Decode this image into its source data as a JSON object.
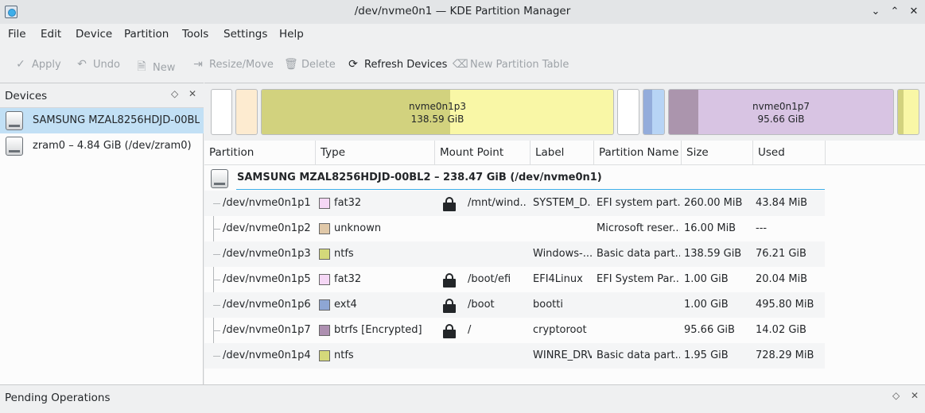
{
  "window": {
    "title": "/dev/nvme0n1 — KDE Partition Manager"
  },
  "menu": [
    "File",
    "Edit",
    "Device",
    "Partition",
    "Tools",
    "Settings",
    "Help"
  ],
  "toolbar": {
    "apply": "Apply",
    "undo": "Undo",
    "new": "New",
    "resize": "Resize/Move",
    "delete": "Delete",
    "refresh": "Refresh Devices",
    "new_table": "New Partition Table"
  },
  "devices": {
    "title": "Devices",
    "items": [
      {
        "label": "SAMSUNG MZAL8256HDJD-00BL..."
      },
      {
        "label": "zram0 – 4.84 GiB (/dev/zram0)"
      }
    ]
  },
  "bar": {
    "p3": {
      "name": "nvme0n1p3",
      "size": "138.59 GiB"
    },
    "p7": {
      "name": "nvme0n1p7",
      "size": "95.66 GiB"
    }
  },
  "columns": [
    "Partition",
    "Type",
    "Mount Point",
    "Label",
    "Partition Name",
    "Size",
    "Used"
  ],
  "group": "SAMSUNG MZAL8256HDJD-00BL2 – 238.47 GiB (/dev/nvme0n1)",
  "partitions": [
    {
      "partition": "/dev/nvme0n1p1",
      "type": "fat32",
      "color": "#f5d7f5",
      "locked": true,
      "mount": "/mnt/wind...",
      "label": "SYSTEM_D...",
      "pname": "EFI system part...",
      "size": "260.00 MiB",
      "used": "43.84 MiB"
    },
    {
      "partition": "/dev/nvme0n1p2",
      "type": "unknown",
      "color": "#e0c8a8",
      "locked": false,
      "mount": "",
      "label": "",
      "pname": "Microsoft reser...",
      "size": "16.00 MiB",
      "used": "---"
    },
    {
      "partition": "/dev/nvme0n1p3",
      "type": "ntfs",
      "color": "#d4d87a",
      "locked": false,
      "mount": "",
      "label": "Windows-...",
      "pname": "Basic data part...",
      "size": "138.59 GiB",
      "used": "76.21 GiB"
    },
    {
      "partition": "/dev/nvme0n1p5",
      "type": "fat32",
      "color": "#f5d7f5",
      "locked": true,
      "mount": "/boot/efi",
      "label": "EFI4Linux",
      "pname": "EFI System Par...",
      "size": "1.00 GiB",
      "used": "20.04 MiB"
    },
    {
      "partition": "/dev/nvme0n1p6",
      "type": "ext4",
      "color": "#8ea6d4",
      "locked": true,
      "mount": "/boot",
      "label": "bootti",
      "pname": "",
      "size": "1.00 GiB",
      "used": "495.80 MiB"
    },
    {
      "partition": "/dev/nvme0n1p7",
      "type": "btrfs [Encrypted]",
      "color": "#ad8fb0",
      "locked": true,
      "mount": "/",
      "label": "cryptoroot",
      "pname": "",
      "size": "95.66 GiB",
      "used": "14.02 GiB"
    },
    {
      "partition": "/dev/nvme0n1p4",
      "type": "ntfs",
      "color": "#d4d87a",
      "locked": false,
      "mount": "",
      "label": "WINRE_DRV",
      "pname": "Basic data part...",
      "size": "1.95 GiB",
      "used": "728.29 MiB"
    }
  ],
  "pending": {
    "title": "Pending Operations"
  },
  "colors": {
    "selection": "#c2e0f5",
    "accent": "#3daee9"
  }
}
